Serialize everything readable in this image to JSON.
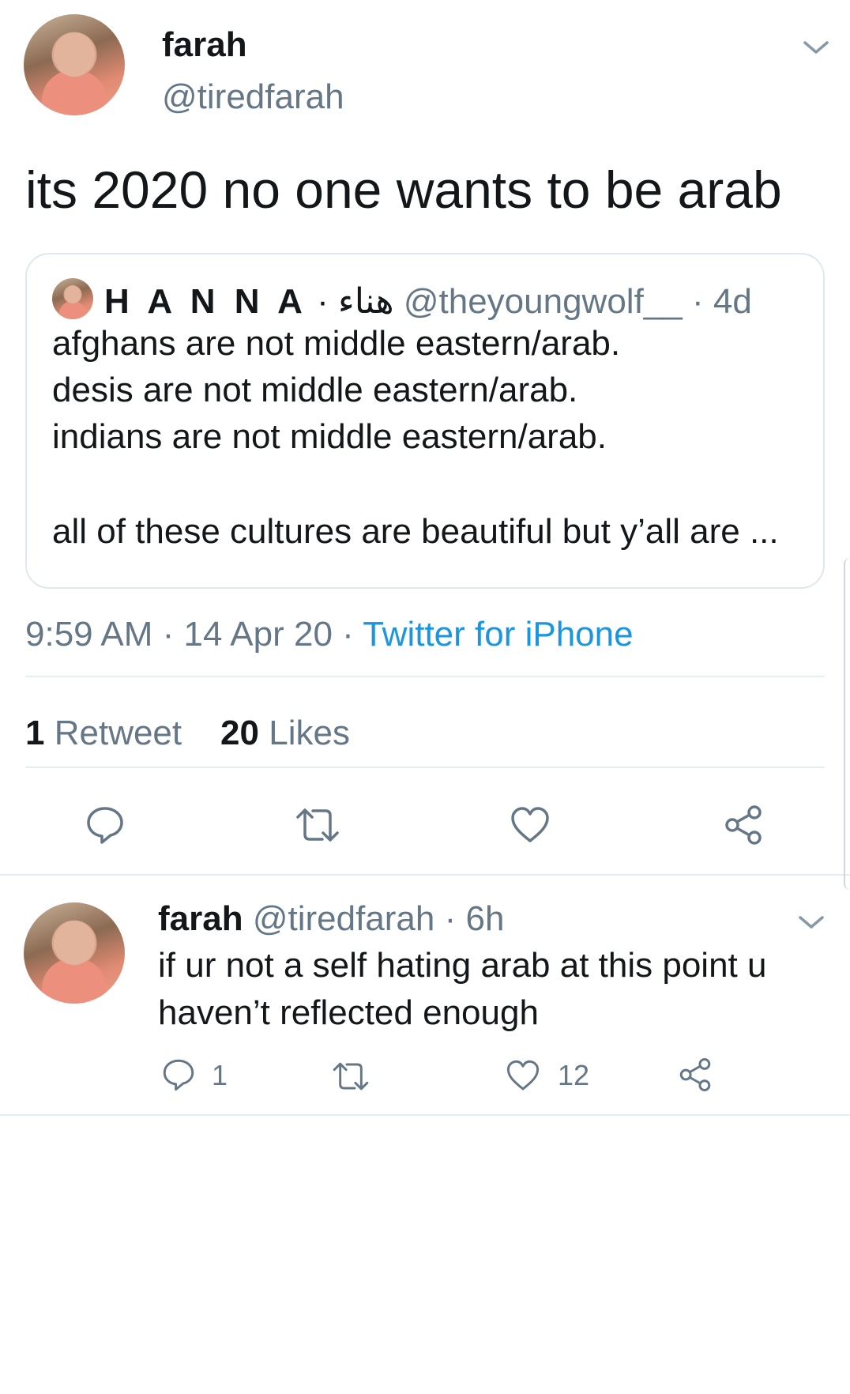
{
  "tweet": {
    "author_name": "farah",
    "author_handle": "@tiredfarah",
    "text": "its 2020 no one wants to be arab",
    "quote": {
      "name": "H A N N A",
      "name_arabic": "· هناء",
      "handle": "@theyoungwolf__",
      "age": "· 4d",
      "lines": [
        "afghans are not middle eastern/arab.",
        "desis are not middle eastern/arab.",
        "indians are not middle eastern/arab.",
        "all of these cultures are beautiful but y’all are ..."
      ]
    },
    "time": "9:59 AM · 14 Apr 20 · ",
    "source": "Twitter for iPhone",
    "retweet_count": "1",
    "retweet_label": "Retweet",
    "likes_count": "20",
    "likes_label": "Likes"
  },
  "reply": {
    "author_name": "farah",
    "author_handle": "@tiredfarah",
    "age": "· 6h",
    "text": "if ur not a self hating arab at this point u haven’t reflected enough",
    "reply_count": "1",
    "like_count": "12"
  },
  "icons": {
    "reply": "reply-icon",
    "retweet": "retweet-icon",
    "like": "heart-icon",
    "share": "share-icon",
    "menu": "chevron-down-icon"
  },
  "colors": {
    "text": "#14171a",
    "secondary": "#657786",
    "link": "#1b95e0",
    "divider": "#e6ecf0"
  }
}
